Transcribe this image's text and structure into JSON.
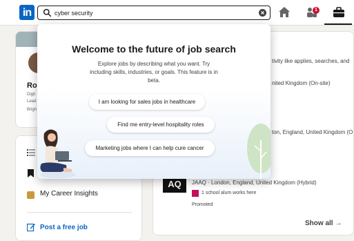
{
  "nav": {
    "logo_text": "in",
    "search_value": "cyber security",
    "notification_count": "1"
  },
  "popover": {
    "title": "Welcome to the future of job search",
    "description": "Explore jobs by describing what you want. Try including skills, industries, or goals. This feature is in beta.",
    "suggestions": [
      "I am looking for sales jobs in healthcare",
      "Find me entry-level hospitality roles",
      "Marketing jobs where I can help cure cancer"
    ]
  },
  "sidebar": {
    "profile_name": "Rol",
    "profile_lines": [
      "Digit",
      "Lead",
      "Brigh"
    ],
    "career_insights": "My Career Insights",
    "post_job": "Post a free job"
  },
  "feed": {
    "activity_snippet": "tivity like applies, searches, and",
    "job1_location": "nited Kingdom (On-site)",
    "job2_location": "ton, England, United Kingdom (O",
    "company_logo_text": "AQ",
    "job3_location": "JAAQ · London, England, United Kingdom (Hybrid)",
    "alumni_text": "1 school alum works here",
    "promoted": "Promoted",
    "show_all": "Show all →"
  },
  "colors": {
    "brand": "#0a66c2",
    "badge": "#cb112d"
  }
}
